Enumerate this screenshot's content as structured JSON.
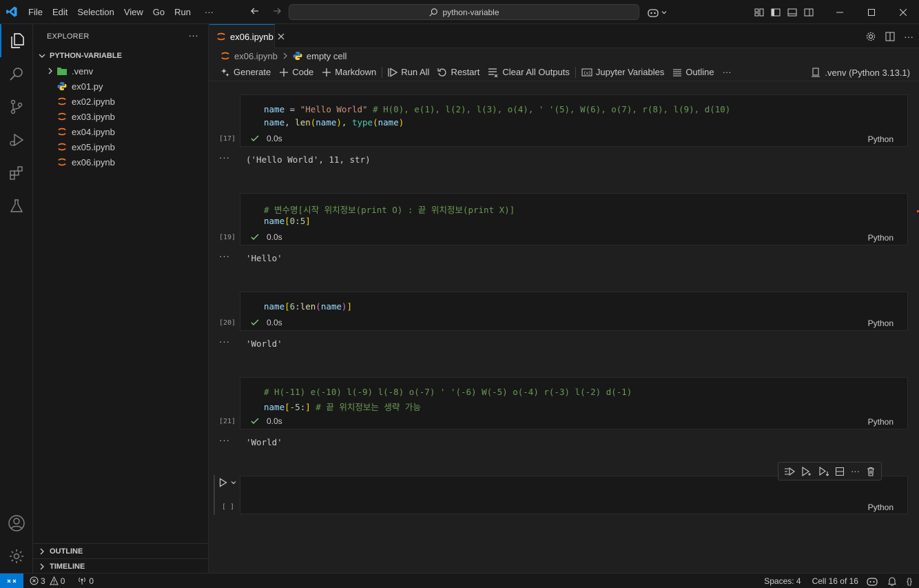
{
  "menu": [
    "File",
    "Edit",
    "Selection",
    "View",
    "Go",
    "Run",
    "···"
  ],
  "search": {
    "label": "python-variable"
  },
  "explorer": {
    "title": "EXPLORER",
    "more": "···",
    "folder": "PYTHON-VARIABLE",
    "items": [
      {
        "name": ".venv",
        "kind": "folder"
      },
      {
        "name": "ex01.py",
        "kind": "python"
      },
      {
        "name": "ex02.ipynb",
        "kind": "notebook"
      },
      {
        "name": "ex03.ipynb",
        "kind": "notebook"
      },
      {
        "name": "ex04.ipynb",
        "kind": "notebook"
      },
      {
        "name": "ex05.ipynb",
        "kind": "notebook"
      },
      {
        "name": "ex06.ipynb",
        "kind": "notebook"
      }
    ],
    "outline": "OUTLINE",
    "timeline": "TIMELINE"
  },
  "tab": {
    "label": "ex06.ipynb"
  },
  "breadcrumb": {
    "file": "ex06.ipynb",
    "cell": "empty cell"
  },
  "toolbar": {
    "generate": "Generate",
    "code": "Code",
    "markdown": "Markdown",
    "run_all": "Run All",
    "restart": "Restart",
    "clear_outputs": "Clear All Outputs",
    "variables": "Jupyter Variables",
    "outline": "Outline",
    "more": "···",
    "kernel": ".venv (Python 3.13.1)"
  },
  "cells": [
    {
      "exec": "[17]",
      "time": "0.0s",
      "lang": "Python",
      "output": "('Hello World', 11, str)"
    },
    {
      "exec": "[19]",
      "time": "0.0s",
      "lang": "Python",
      "output": "'Hello'"
    },
    {
      "exec": "[20]",
      "time": "0.0s",
      "lang": "Python",
      "output": "'World'"
    },
    {
      "exec": "[21]",
      "time": "0.0s",
      "lang": "Python",
      "output": "'World'"
    },
    {
      "exec": "[ ]",
      "lang": "Python"
    }
  ],
  "code": {
    "c1_comment": "# H(0), e(1), l(2), l(3), o(4), ' '(5), W(6), o(7), r(8), l(9), d(10)",
    "c2_comment": "# 변수명[시작 위치정보(print O) : 끝 위치정보(print X)]",
    "c4_comment1": "# H(-11) e(-10) l(-9) l(-8) o(-7) ' '(-6) W(-5) o(-4) r(-3) l(-2) d(-1)",
    "c4_comment2": "# 끝 위치정보는 생략 가능"
  },
  "outdots": "···",
  "statusbar": {
    "errors": "3",
    "warnings": "0",
    "ports": "0",
    "spaces": "Spaces: 4",
    "cell": "Cell 16 of 16",
    "braces": "{}"
  }
}
